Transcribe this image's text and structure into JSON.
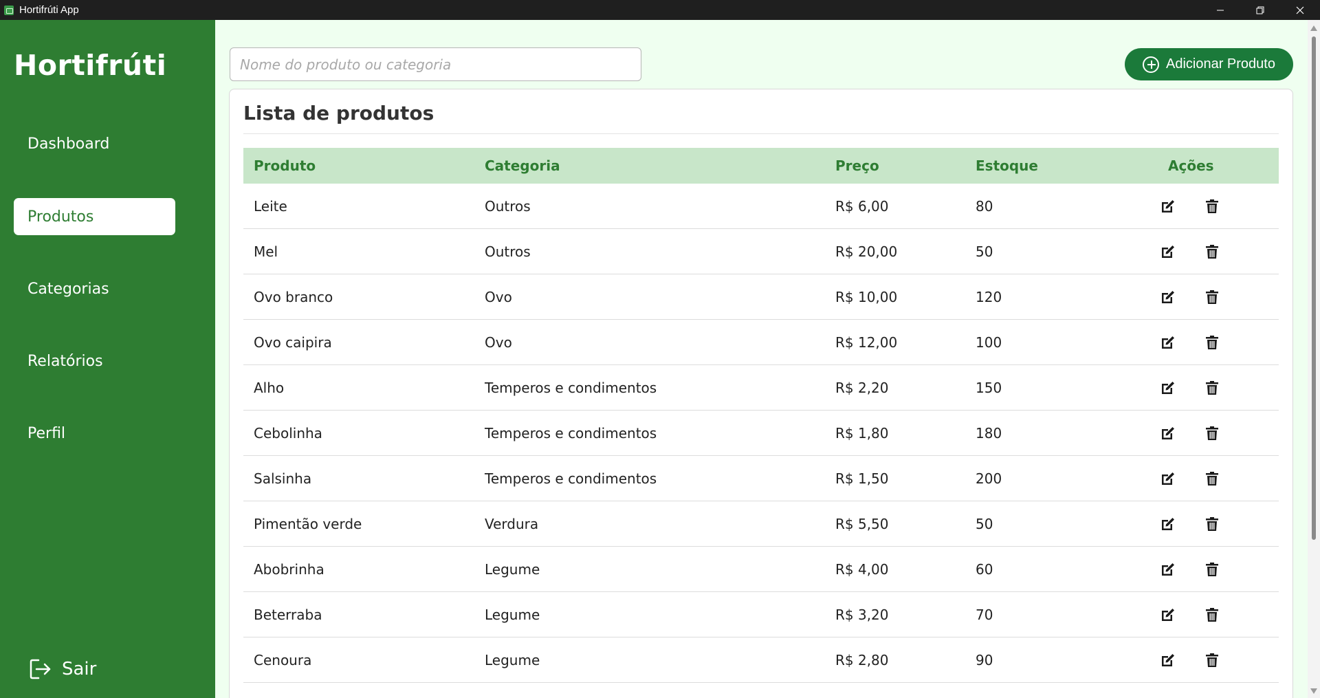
{
  "window": {
    "title": "Hortifrúti App",
    "controls": [
      "minimize",
      "restore",
      "close"
    ]
  },
  "sidebar": {
    "brand": "Hortifrúti",
    "items": [
      {
        "label": "Dashboard",
        "active": false
      },
      {
        "label": "Produtos",
        "active": true
      },
      {
        "label": "Categorias",
        "active": false
      },
      {
        "label": "Relatórios",
        "active": false
      },
      {
        "label": "Perfil",
        "active": false
      }
    ],
    "logout_label": "Sair"
  },
  "toolbar": {
    "search_placeholder": "Nome do produto ou categoria",
    "search_value": "",
    "add_button_label": "Adicionar Produto"
  },
  "products": {
    "title": "Lista de produtos",
    "columns": [
      "Produto",
      "Categoria",
      "Preço",
      "Estoque",
      "Ações"
    ],
    "rows": [
      {
        "produto": "Leite",
        "categoria": "Outros",
        "preco": "R$ 6,00",
        "estoque": "80"
      },
      {
        "produto": "Mel",
        "categoria": "Outros",
        "preco": "R$ 20,00",
        "estoque": "50"
      },
      {
        "produto": "Ovo branco",
        "categoria": "Ovo",
        "preco": "R$ 10,00",
        "estoque": "120"
      },
      {
        "produto": "Ovo caipira",
        "categoria": "Ovo",
        "preco": "R$ 12,00",
        "estoque": "100"
      },
      {
        "produto": "Alho",
        "categoria": "Temperos e condimentos",
        "preco": "R$ 2,20",
        "estoque": "150"
      },
      {
        "produto": "Cebolinha",
        "categoria": "Temperos e condimentos",
        "preco": "R$ 1,80",
        "estoque": "180"
      },
      {
        "produto": "Salsinha",
        "categoria": "Temperos e condimentos",
        "preco": "R$ 1,50",
        "estoque": "200"
      },
      {
        "produto": "Pimentão verde",
        "categoria": "Verdura",
        "preco": "R$ 5,50",
        "estoque": "50"
      },
      {
        "produto": "Abobrinha",
        "categoria": "Legume",
        "preco": "R$ 4,00",
        "estoque": "60"
      },
      {
        "produto": "Beterraba",
        "categoria": "Legume",
        "preco": "R$ 3,20",
        "estoque": "70"
      },
      {
        "produto": "Cenoura",
        "categoria": "Legume",
        "preco": "R$ 2,80",
        "estoque": "90"
      }
    ],
    "row_actions": [
      "edit-icon",
      "trash-icon"
    ]
  },
  "colors": {
    "sidebar": "#2e7d32",
    "accent_button": "#1b7a3a",
    "table_header_bg": "#c8e6c9",
    "page_bg": "#effff0"
  }
}
